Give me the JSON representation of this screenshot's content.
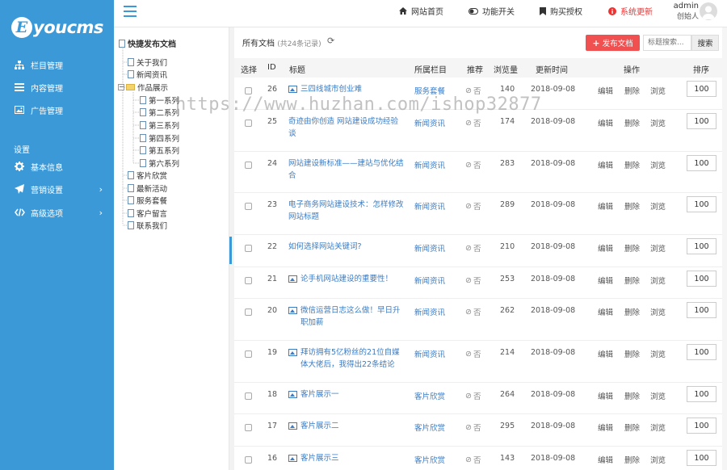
{
  "brand": {
    "logo_letter": "E",
    "logo_text": "youcms"
  },
  "sidebar": {
    "items": [
      {
        "label": "栏目管理",
        "icon": "sitemap-icon"
      },
      {
        "label": "内容管理",
        "icon": "list-icon"
      },
      {
        "label": "广告管理",
        "icon": "image-icon"
      }
    ],
    "section_label": "设置",
    "settings_items": [
      {
        "label": "基本信息",
        "icon": "gear-icon"
      },
      {
        "label": "营销设置",
        "icon": "send-icon"
      },
      {
        "label": "高级选项",
        "icon": "code-icon"
      }
    ]
  },
  "topbar": {
    "links": [
      {
        "label": "网站首页",
        "icon": "home-icon"
      },
      {
        "label": "功能开关",
        "icon": "toggle-icon"
      },
      {
        "label": "购买授权",
        "icon": "bookmark-icon"
      },
      {
        "label": "系统更新",
        "icon": "info-icon",
        "color": "#e33333"
      }
    ],
    "user_name": "admin",
    "user_role": "创始人"
  },
  "tree": {
    "title": "快捷发布文档",
    "nodes": [
      "关于我们",
      "新闻资讯",
      "作品展示",
      "第一系列",
      "第二系列",
      "第三系列",
      "第四系列",
      "第五系列",
      "第六系列",
      "客片欣赏",
      "最新活动",
      "服务套餐",
      "客户留言",
      "联系我们"
    ]
  },
  "main": {
    "tab_label": "所有文档",
    "tab_count": "(共24条记录)",
    "publish_label": "发布文档",
    "search_placeholder": "标题搜索...",
    "search_button": "搜索",
    "columns": [
      "选择",
      "ID",
      "标题",
      "所属栏目",
      "推荐",
      "浏览量",
      "更新时间",
      "操作",
      "排序"
    ],
    "rows": [
      {
        "id": "26",
        "title": "三四线城市创业难",
        "has_img": true,
        "category": "服务套餐",
        "recommend": "否",
        "views": "140",
        "date": "2018-09-08",
        "sort": "100"
      },
      {
        "id": "25",
        "title": "奇迹由你创造 网站建设成功经验谈",
        "has_img": false,
        "category": "新闻资讯",
        "recommend": "否",
        "views": "174",
        "date": "2018-09-08",
        "sort": "100"
      },
      {
        "id": "24",
        "title": "网站建设新标准——建站与优化结合",
        "has_img": false,
        "category": "新闻资讯",
        "recommend": "否",
        "views": "283",
        "date": "2018-09-08",
        "sort": "100"
      },
      {
        "id": "23",
        "title": "电子商务网站建设技术：怎样修改网站标题",
        "has_img": false,
        "category": "新闻资讯",
        "recommend": "否",
        "views": "289",
        "date": "2018-09-08",
        "sort": "100"
      },
      {
        "id": "22",
        "title": "如何选择网站关键词?",
        "has_img": false,
        "category": "新闻资讯",
        "recommend": "否",
        "views": "210",
        "date": "2018-09-08",
        "sort": "100"
      },
      {
        "id": "21",
        "title": "论手机网站建设的重要性！",
        "has_img": true,
        "category": "新闻资讯",
        "recommend": "否",
        "views": "253",
        "date": "2018-09-08",
        "sort": "100"
      },
      {
        "id": "20",
        "title": "微信运营日志这么做！早日升职加薪",
        "has_img": true,
        "category": "新闻资讯",
        "recommend": "否",
        "views": "262",
        "date": "2018-09-08",
        "sort": "100"
      },
      {
        "id": "19",
        "title": "拜访拥有5亿粉丝的21位自媒体大佬后，我得出22条结论",
        "has_img": true,
        "category": "新闻资讯",
        "recommend": "否",
        "views": "214",
        "date": "2018-09-08",
        "sort": "100"
      },
      {
        "id": "18",
        "title": "客片展示一",
        "has_img": true,
        "category": "客片欣赏",
        "recommend": "否",
        "views": "264",
        "date": "2018-09-08",
        "sort": "100"
      },
      {
        "id": "17",
        "title": "客片展示二",
        "has_img": true,
        "category": "客片欣赏",
        "recommend": "否",
        "views": "295",
        "date": "2018-09-08",
        "sort": "100"
      },
      {
        "id": "16",
        "title": "客片展示三",
        "has_img": true,
        "category": "客片欣赏",
        "recommend": "否",
        "views": "143",
        "date": "2018-09-08",
        "sort": "100"
      }
    ],
    "actions": [
      "编辑",
      "删除",
      "浏览"
    ]
  },
  "watermark": "https://www.huzhan.com/ishop32877"
}
